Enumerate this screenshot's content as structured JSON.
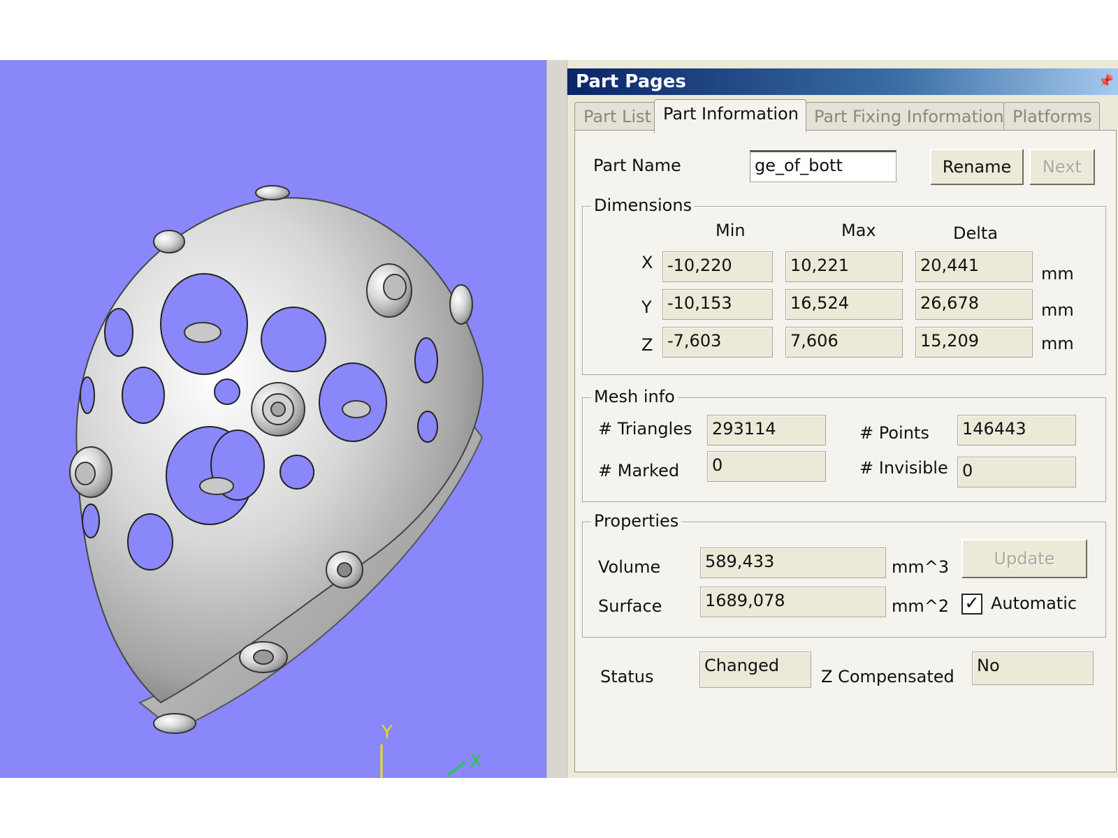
{
  "viewport": {
    "background": "#8a87fb",
    "axis_y_label": "Y",
    "axis_x_label": "X"
  },
  "panel": {
    "title": "Part Pages",
    "tabs": [
      {
        "label": "Part List",
        "active": false
      },
      {
        "label": "Part Information",
        "active": true
      },
      {
        "label": "Part Fixing Information",
        "active": false
      },
      {
        "label": "Platforms",
        "active": false
      }
    ],
    "part_name_label": "Part Name",
    "part_name_value": "ge_of_bott",
    "rename_label": "Rename",
    "next_label": "Next",
    "dimensions": {
      "title": "Dimensions",
      "col_min": "Min",
      "col_max": "Max",
      "col_delta": "Delta",
      "rows": [
        {
          "axis": "X",
          "min": "-10,220",
          "max": "10,221",
          "delta": "20,441",
          "unit": "mm"
        },
        {
          "axis": "Y",
          "min": "-10,153",
          "max": "16,524",
          "delta": "26,678",
          "unit": "mm"
        },
        {
          "axis": "Z",
          "min": "-7,603",
          "max": "7,606",
          "delta": "15,209",
          "unit": "mm"
        }
      ]
    },
    "mesh": {
      "title": "Mesh info",
      "triangles_label": "# Triangles",
      "triangles": "293114",
      "points_label": "# Points",
      "points": "146443",
      "marked_label": "# Marked",
      "marked": "0",
      "invisible_label": "# Invisible",
      "invisible": "0"
    },
    "properties": {
      "title": "Properties",
      "volume_label": "Volume",
      "volume": "589,433",
      "volume_unit": "mm^3",
      "surface_label": "Surface",
      "surface": "1689,078",
      "surface_unit": "mm^2",
      "update_label": "Update",
      "automatic_label": "Automatic",
      "automatic_checked": true,
      "check_mark": "✓"
    },
    "status_label": "Status",
    "status_value": "Changed",
    "zcomp_label": "Z Compensated",
    "zcomp_value": "No"
  }
}
